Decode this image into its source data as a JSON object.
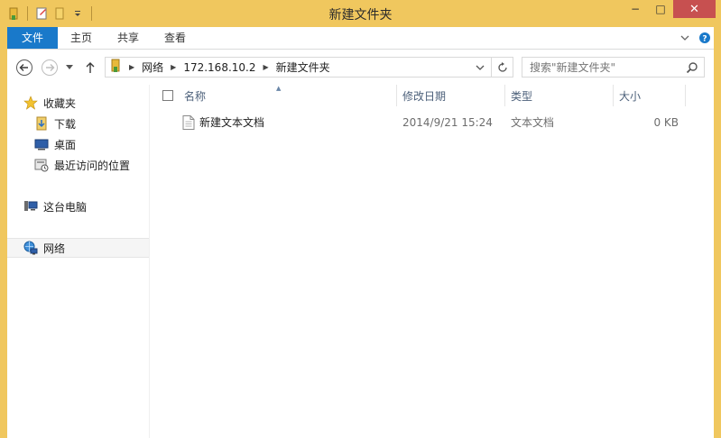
{
  "window": {
    "title": "新建文件夹",
    "controls": {
      "minimize": "−",
      "maximize": "□",
      "close": "✕"
    }
  },
  "ribbon": {
    "tabs": [
      "文件",
      "主页",
      "共享",
      "查看"
    ]
  },
  "address": {
    "crumbs": [
      "网络",
      "172.168.10.2",
      "新建文件夹"
    ]
  },
  "search": {
    "placeholder": "搜索\"新建文件夹\""
  },
  "sidebar": {
    "items": [
      {
        "label": "收藏夹",
        "icon": "star-icon"
      },
      {
        "label": "下载",
        "icon": "downloads-folder-icon"
      },
      {
        "label": "桌面",
        "icon": "desktop-icon"
      },
      {
        "label": "最近访问的位置",
        "icon": "recent-places-icon"
      },
      {
        "label": "这台电脑",
        "icon": "computer-icon"
      },
      {
        "label": "网络",
        "icon": "network-icon",
        "selected": true
      }
    ]
  },
  "columns": [
    "名称",
    "修改日期",
    "类型",
    "大小"
  ],
  "files": [
    {
      "name": "新建文本文档",
      "modified": "2014/9/21 15:24",
      "type": "文本文档",
      "size": "0 KB",
      "icon": "text-file-icon"
    }
  ],
  "colors": {
    "titlebar": "#f0c75e",
    "accent": "#1979ca",
    "close": "#c75050",
    "header_text": "#4c607a"
  }
}
